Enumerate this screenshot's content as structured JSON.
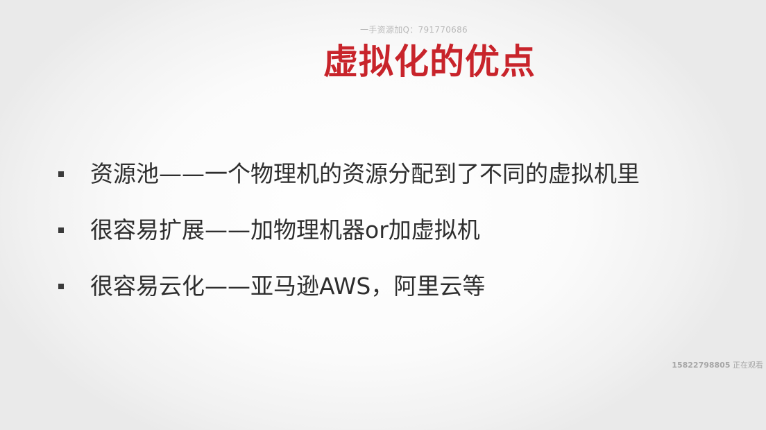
{
  "slide": {
    "watermark_top": "一手资源加Q：791770686",
    "title": "虚拟化的优点",
    "bullets": [
      "资源池——一个物理机的资源分配到了不同的虚拟机里",
      "很容易扩展——加物理机器or加虚拟机",
      "很容易云化——亚马逊AWS，阿里云等"
    ],
    "viewer_id": "15822798805",
    "viewer_status": "正在观看"
  },
  "colors": {
    "title": "#c8242b",
    "text": "#2e2e2e"
  },
  "icons": {
    "bullet": "square-bullet-icon"
  }
}
